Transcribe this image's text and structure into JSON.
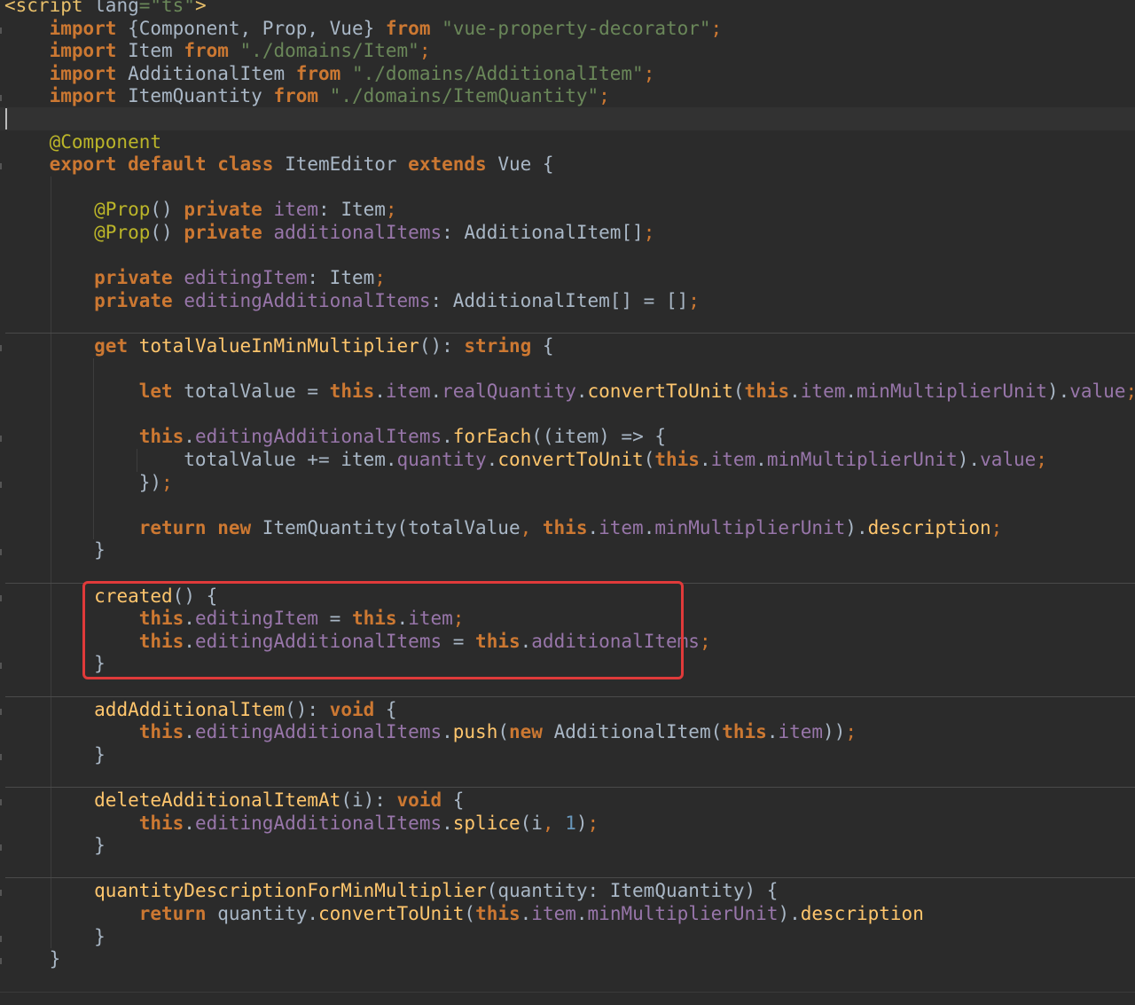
{
  "editor": {
    "language": "TypeScript (Vue SFC)",
    "theme_colors": {
      "background": "#2b2b2b",
      "keyword": "#cc7832",
      "string": "#6a8759",
      "annotation": "#bbb529",
      "field": "#9876aa",
      "method": "#ffc66d",
      "number": "#6897bb",
      "plain": "#a9b7c6",
      "highlight_border": "#e03a3a"
    },
    "highlight": {
      "label": "highlighted created() hook",
      "from_line": 26,
      "to_line": 29
    },
    "lines": [
      [
        [
          "tag",
          "<script "
        ],
        [
          "pl",
          "lang"
        ],
        [
          "str",
          "=\"ts\""
        ],
        [
          "tag",
          ">"
        ]
      ],
      [
        [
          "pl",
          "    "
        ],
        [
          "kw",
          "import "
        ],
        [
          "pl",
          "{Component, Prop, Vue} "
        ],
        [
          "kw",
          "from "
        ],
        [
          "str",
          "\"vue-property-decorator\""
        ],
        [
          "punct",
          ";"
        ]
      ],
      [
        [
          "pl",
          "    "
        ],
        [
          "kw",
          "import "
        ],
        [
          "pl",
          "Item "
        ],
        [
          "kw",
          "from "
        ],
        [
          "str",
          "\"./domains/Item\""
        ],
        [
          "punct",
          ";"
        ]
      ],
      [
        [
          "pl",
          "    "
        ],
        [
          "kw",
          "import "
        ],
        [
          "pl",
          "AdditionalItem "
        ],
        [
          "kw",
          "from "
        ],
        [
          "str",
          "\"./domains/AdditionalItem\""
        ],
        [
          "punct",
          ";"
        ]
      ],
      [
        [
          "pl",
          "    "
        ],
        [
          "kw",
          "import "
        ],
        [
          "pl",
          "ItemQuantity "
        ],
        [
          "kw",
          "from "
        ],
        [
          "str",
          "\"./domains/ItemQuantity\""
        ],
        [
          "punct",
          ";"
        ]
      ],
      [],
      [
        [
          "pl",
          "    "
        ],
        [
          "ann",
          "@Component"
        ]
      ],
      [
        [
          "pl",
          "    "
        ],
        [
          "kw",
          "export default class "
        ],
        [
          "pl",
          "ItemEditor "
        ],
        [
          "kw",
          "extends "
        ],
        [
          "pl",
          "Vue {"
        ]
      ],
      [],
      [
        [
          "pl",
          "        "
        ],
        [
          "ann",
          "@Prop"
        ],
        [
          "pl",
          "() "
        ],
        [
          "kw",
          "private "
        ],
        [
          "fld",
          "item"
        ],
        [
          "pl",
          ": Item"
        ],
        [
          "punct",
          ";"
        ]
      ],
      [
        [
          "pl",
          "        "
        ],
        [
          "ann",
          "@Prop"
        ],
        [
          "pl",
          "() "
        ],
        [
          "kw",
          "private "
        ],
        [
          "fld",
          "additionalItems"
        ],
        [
          "pl",
          ": AdditionalItem[]"
        ],
        [
          "punct",
          ";"
        ]
      ],
      [],
      [
        [
          "pl",
          "        "
        ],
        [
          "kw",
          "private "
        ],
        [
          "fld",
          "editingItem"
        ],
        [
          "pl",
          ": Item"
        ],
        [
          "punct",
          ";"
        ]
      ],
      [
        [
          "pl",
          "        "
        ],
        [
          "kw",
          "private "
        ],
        [
          "fld",
          "editingAdditionalItems"
        ],
        [
          "pl",
          ": AdditionalItem[] = []"
        ],
        [
          "punct",
          ";"
        ]
      ],
      [],
      [
        [
          "pl",
          "        "
        ],
        [
          "kw",
          "get "
        ],
        [
          "fn",
          "totalValueInMinMultiplier"
        ],
        [
          "pl",
          "(): "
        ],
        [
          "kw",
          "string "
        ],
        [
          "pl",
          "{"
        ]
      ],
      [],
      [
        [
          "pl",
          "            "
        ],
        [
          "kw",
          "let "
        ],
        [
          "pl",
          "totalValue = "
        ],
        [
          "kw",
          "this"
        ],
        [
          "pl",
          "."
        ],
        [
          "fld",
          "item"
        ],
        [
          "pl",
          "."
        ],
        [
          "fld",
          "realQuantity"
        ],
        [
          "pl",
          "."
        ],
        [
          "fn",
          "convertToUnit"
        ],
        [
          "pl",
          "("
        ],
        [
          "kw",
          "this"
        ],
        [
          "pl",
          "."
        ],
        [
          "fld",
          "item"
        ],
        [
          "pl",
          "."
        ],
        [
          "fld",
          "minMultiplierUnit"
        ],
        [
          "pl",
          ")."
        ],
        [
          "fld",
          "value"
        ],
        [
          "punct",
          ";"
        ]
      ],
      [],
      [
        [
          "pl",
          "            "
        ],
        [
          "kw",
          "this"
        ],
        [
          "pl",
          "."
        ],
        [
          "fld",
          "editingAdditionalItems"
        ],
        [
          "pl",
          "."
        ],
        [
          "fn",
          "forEach"
        ],
        [
          "pl",
          "((item) => {"
        ]
      ],
      [
        [
          "pl",
          "                totalValue += item."
        ],
        [
          "fld",
          "quantity"
        ],
        [
          "pl",
          "."
        ],
        [
          "fn",
          "convertToUnit"
        ],
        [
          "pl",
          "("
        ],
        [
          "kw",
          "this"
        ],
        [
          "pl",
          "."
        ],
        [
          "fld",
          "item"
        ],
        [
          "pl",
          "."
        ],
        [
          "fld",
          "minMultiplierUnit"
        ],
        [
          "pl",
          ")."
        ],
        [
          "fld",
          "value"
        ],
        [
          "punct",
          ";"
        ]
      ],
      [
        [
          "pl",
          "            })"
        ],
        [
          "punct",
          ";"
        ]
      ],
      [],
      [
        [
          "pl",
          "            "
        ],
        [
          "kw",
          "return new "
        ],
        [
          "pl",
          "ItemQuantity(totalValue"
        ],
        [
          "punct",
          ", "
        ],
        [
          "kw",
          "this"
        ],
        [
          "pl",
          "."
        ],
        [
          "fld",
          "item"
        ],
        [
          "pl",
          "."
        ],
        [
          "fld",
          "minMultiplierUnit"
        ],
        [
          "pl",
          ")."
        ],
        [
          "fn",
          "description"
        ],
        [
          "punct",
          ";"
        ]
      ],
      [
        [
          "pl",
          "        }"
        ]
      ],
      [],
      [
        [
          "pl",
          "        "
        ],
        [
          "fn",
          "created"
        ],
        [
          "pl",
          "() {"
        ]
      ],
      [
        [
          "pl",
          "            "
        ],
        [
          "kw",
          "this"
        ],
        [
          "pl",
          "."
        ],
        [
          "fld",
          "editingItem"
        ],
        [
          "pl",
          " = "
        ],
        [
          "kw",
          "this"
        ],
        [
          "pl",
          "."
        ],
        [
          "fld",
          "item"
        ],
        [
          "punct",
          ";"
        ]
      ],
      [
        [
          "pl",
          "            "
        ],
        [
          "kw",
          "this"
        ],
        [
          "pl",
          "."
        ],
        [
          "fld",
          "editingAdditionalItems"
        ],
        [
          "pl",
          " = "
        ],
        [
          "kw",
          "this"
        ],
        [
          "pl",
          "."
        ],
        [
          "fld",
          "additionalItems"
        ],
        [
          "punct",
          ";"
        ]
      ],
      [
        [
          "pl",
          "        }"
        ]
      ],
      [],
      [
        [
          "pl",
          "        "
        ],
        [
          "fn",
          "addAdditionalItem"
        ],
        [
          "pl",
          "(): "
        ],
        [
          "kw",
          "void "
        ],
        [
          "pl",
          "{"
        ]
      ],
      [
        [
          "pl",
          "            "
        ],
        [
          "kw",
          "this"
        ],
        [
          "pl",
          "."
        ],
        [
          "fld",
          "editingAdditionalItems"
        ],
        [
          "pl",
          "."
        ],
        [
          "fn",
          "push"
        ],
        [
          "pl",
          "("
        ],
        [
          "kw",
          "new "
        ],
        [
          "pl",
          "AdditionalItem("
        ],
        [
          "kw",
          "this"
        ],
        [
          "pl",
          "."
        ],
        [
          "fld",
          "item"
        ],
        [
          "pl",
          "))"
        ],
        [
          "punct",
          ";"
        ]
      ],
      [
        [
          "pl",
          "        }"
        ]
      ],
      [],
      [
        [
          "pl",
          "        "
        ],
        [
          "fn",
          "deleteAdditionalItemAt"
        ],
        [
          "pl",
          "(i): "
        ],
        [
          "kw",
          "void "
        ],
        [
          "pl",
          "{"
        ]
      ],
      [
        [
          "pl",
          "            "
        ],
        [
          "kw",
          "this"
        ],
        [
          "pl",
          "."
        ],
        [
          "fld",
          "editingAdditionalItems"
        ],
        [
          "pl",
          "."
        ],
        [
          "fn",
          "splice"
        ],
        [
          "pl",
          "(i"
        ],
        [
          "punct",
          ", "
        ],
        [
          "num",
          "1"
        ],
        [
          "pl",
          ")"
        ],
        [
          "punct",
          ";"
        ]
      ],
      [
        [
          "pl",
          "        }"
        ]
      ],
      [],
      [
        [
          "pl",
          "        "
        ],
        [
          "fn",
          "quantityDescriptionForMinMultiplier"
        ],
        [
          "pl",
          "(quantity: ItemQuantity) {"
        ]
      ],
      [
        [
          "pl",
          "            "
        ],
        [
          "kw",
          "return "
        ],
        [
          "pl",
          "quantity."
        ],
        [
          "fn",
          "convertToUnit"
        ],
        [
          "pl",
          "("
        ],
        [
          "kw",
          "this"
        ],
        [
          "pl",
          "."
        ],
        [
          "fld",
          "item"
        ],
        [
          "pl",
          "."
        ],
        [
          "fld",
          "minMultiplierUnit"
        ],
        [
          "pl",
          ")."
        ],
        [
          "fn",
          "description"
        ]
      ],
      [
        [
          "pl",
          "        }"
        ]
      ],
      [
        [
          "pl",
          "    }"
        ]
      ]
    ]
  }
}
